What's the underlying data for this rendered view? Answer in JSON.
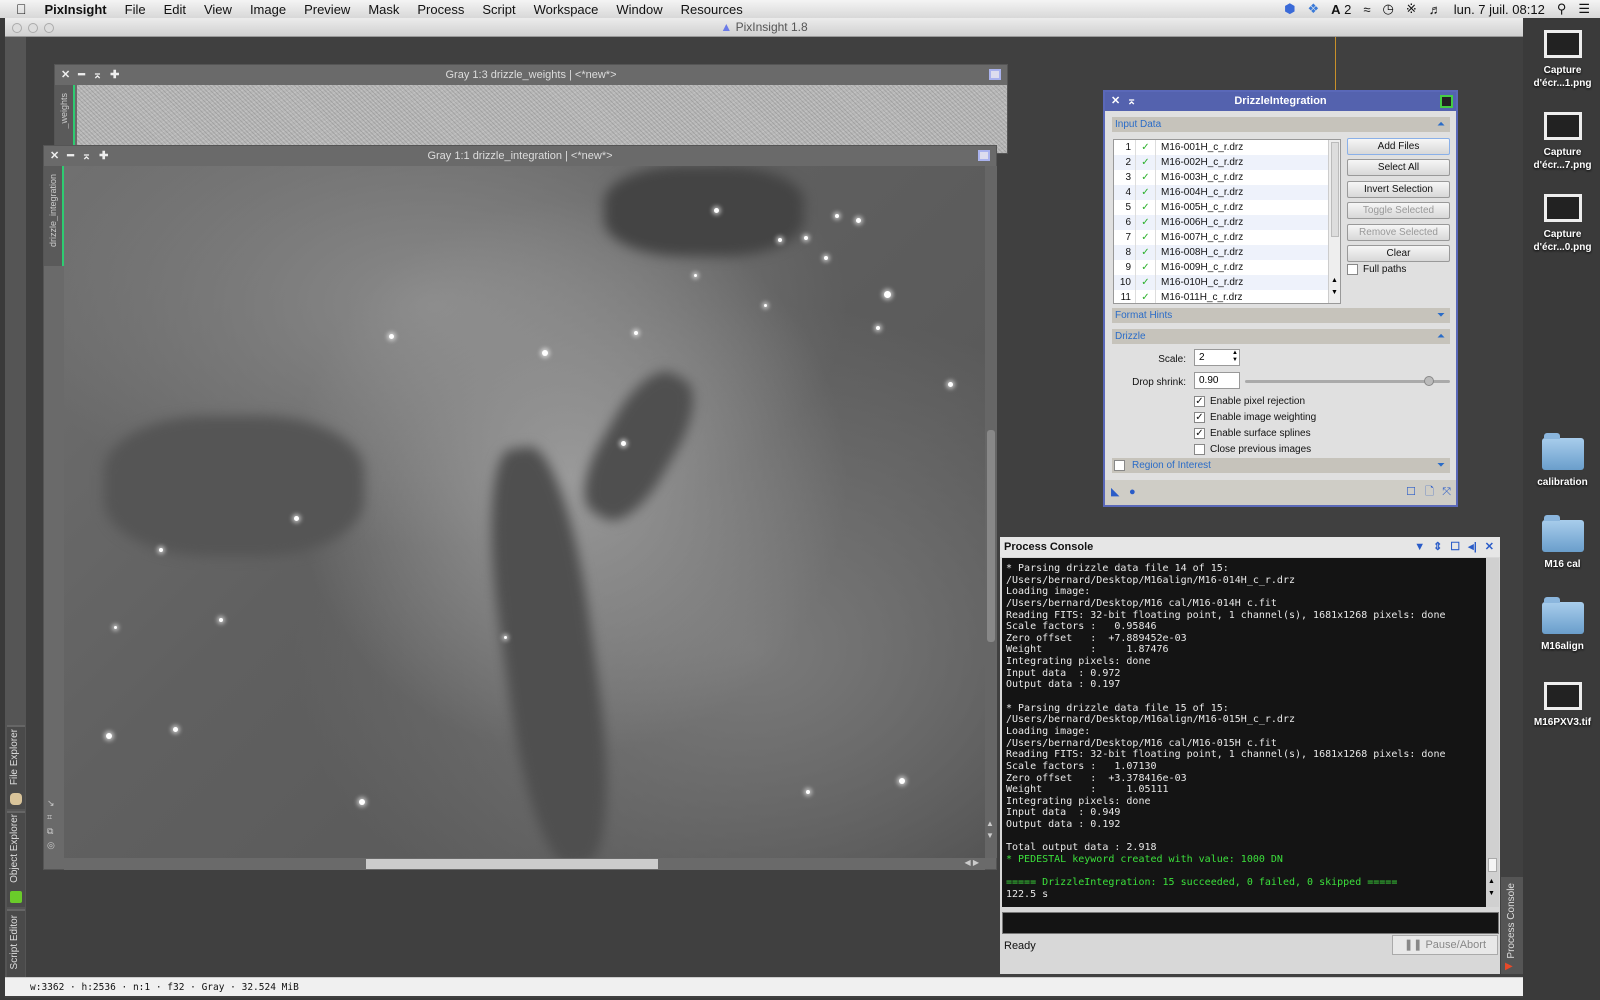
{
  "menubar": {
    "app": "PixInsight",
    "items": [
      "File",
      "Edit",
      "View",
      "Image",
      "Preview",
      "Mask",
      "Process",
      "Script",
      "Workspace",
      "Window",
      "Resources"
    ],
    "status_badge": "2",
    "clock": "lun. 7 juil. 08:12"
  },
  "window": {
    "title": "PixInsight 1.8"
  },
  "left_tabs": [
    "File Explorer",
    "Object Explorer",
    "Script Editor"
  ],
  "image_windows": [
    {
      "title": "Gray 1:3 drizzle_weights | <*new*>",
      "side_tab": "_weights"
    },
    {
      "title": "Gray 1:1 drizzle_integration | <*new*>",
      "side_tab": "drizzle_integration"
    }
  ],
  "drizzle": {
    "title": "DrizzleIntegration",
    "input_data_label": "Input Data",
    "files": [
      {
        "n": "1",
        "name": "M16-001H_c_r.drz"
      },
      {
        "n": "2",
        "name": "M16-002H_c_r.drz"
      },
      {
        "n": "3",
        "name": "M16-003H_c_r.drz"
      },
      {
        "n": "4",
        "name": "M16-004H_c_r.drz"
      },
      {
        "n": "5",
        "name": "M16-005H_c_r.drz"
      },
      {
        "n": "6",
        "name": "M16-006H_c_r.drz"
      },
      {
        "n": "7",
        "name": "M16-007H_c_r.drz"
      },
      {
        "n": "8",
        "name": "M16-008H_c_r.drz"
      },
      {
        "n": "9",
        "name": "M16-009H_c_r.drz"
      },
      {
        "n": "10",
        "name": "M16-010H_c_r.drz"
      },
      {
        "n": "11",
        "name": "M16-011H_c_r.drz"
      }
    ],
    "buttons": {
      "add": "Add Files",
      "select_all": "Select All",
      "invert": "Invert Selection",
      "toggle": "Toggle Selected",
      "remove": "Remove Selected",
      "clear": "Clear"
    },
    "full_paths": "Full paths",
    "format_hints_label": "Format Hints",
    "drizzle_label": "Drizzle",
    "scale_label": "Scale:",
    "scale_value": "2",
    "drop_shrink_label": "Drop shrink:",
    "drop_shrink_value": "0.90",
    "options": [
      {
        "label": "Enable pixel rejection",
        "checked": true
      },
      {
        "label": "Enable image weighting",
        "checked": true
      },
      {
        "label": "Enable surface splines",
        "checked": true
      },
      {
        "label": "Close previous images",
        "checked": false
      }
    ],
    "roi_label": "Region of Interest"
  },
  "console": {
    "title": "Process Console",
    "lines": [
      {
        "t": "* Parsing drizzle data file 14 of 15:"
      },
      {
        "t": "/Users/bernard/Desktop/M16align/M16-014H_c_r.drz"
      },
      {
        "t": "Loading image:"
      },
      {
        "t": "/Users/bernard/Desktop/M16 cal/M16-014H c.fit"
      },
      {
        "t": "Reading FITS: 32-bit floating point, 1 channel(s), 1681x1268 pixels: done"
      },
      {
        "t": "Scale factors :   0.95846"
      },
      {
        "t": "Zero offset   :  +7.889452e-03"
      },
      {
        "t": "Weight        :     1.87476"
      },
      {
        "t": "Integrating pixels: done"
      },
      {
        "t": "Input data  : 0.972"
      },
      {
        "t": "Output data : 0.197"
      },
      {
        "t": ""
      },
      {
        "t": "* Parsing drizzle data file 15 of 15:"
      },
      {
        "t": "/Users/bernard/Desktop/M16align/M16-015H_c_r.drz"
      },
      {
        "t": "Loading image:"
      },
      {
        "t": "/Users/bernard/Desktop/M16 cal/M16-015H c.fit"
      },
      {
        "t": "Reading FITS: 32-bit floating point, 1 channel(s), 1681x1268 pixels: done"
      },
      {
        "t": "Scale factors :   1.07130"
      },
      {
        "t": "Zero offset   :  +3.378416e-03"
      },
      {
        "t": "Weight        :     1.05111"
      },
      {
        "t": "Integrating pixels: done"
      },
      {
        "t": "Input data  : 0.949"
      },
      {
        "t": "Output data : 0.192"
      },
      {
        "t": ""
      },
      {
        "t": "Total output data : 2.918"
      },
      {
        "t": "* PEDESTAL keyword created with value: 1000 DN",
        "green": true
      },
      {
        "t": ""
      },
      {
        "t": "===== DrizzleIntegration: 15 succeeded, 0 failed, 0 skipped =====",
        "green": true
      },
      {
        "t": "122.5 s"
      }
    ],
    "status": "Ready",
    "pause_label": "Pause/Abort",
    "side_tab": "Process Console"
  },
  "statusbar": "w:3362 · h:2536 · n:1 · f32 · Gray · 32.524 MiB",
  "desktop": [
    {
      "label": "Capture d'écr...1.png",
      "kind": "thumb"
    },
    {
      "label": "Capture d'écr...7.png",
      "kind": "thumb"
    },
    {
      "label": "Capture d'écr...0.png",
      "kind": "thumb"
    },
    {
      "label": "calibration",
      "kind": "folder"
    },
    {
      "label": "M16 cal",
      "kind": "folder"
    },
    {
      "label": "M16align",
      "kind": "folder"
    },
    {
      "label": "M16PXV3.tif",
      "kind": "thumb"
    }
  ]
}
